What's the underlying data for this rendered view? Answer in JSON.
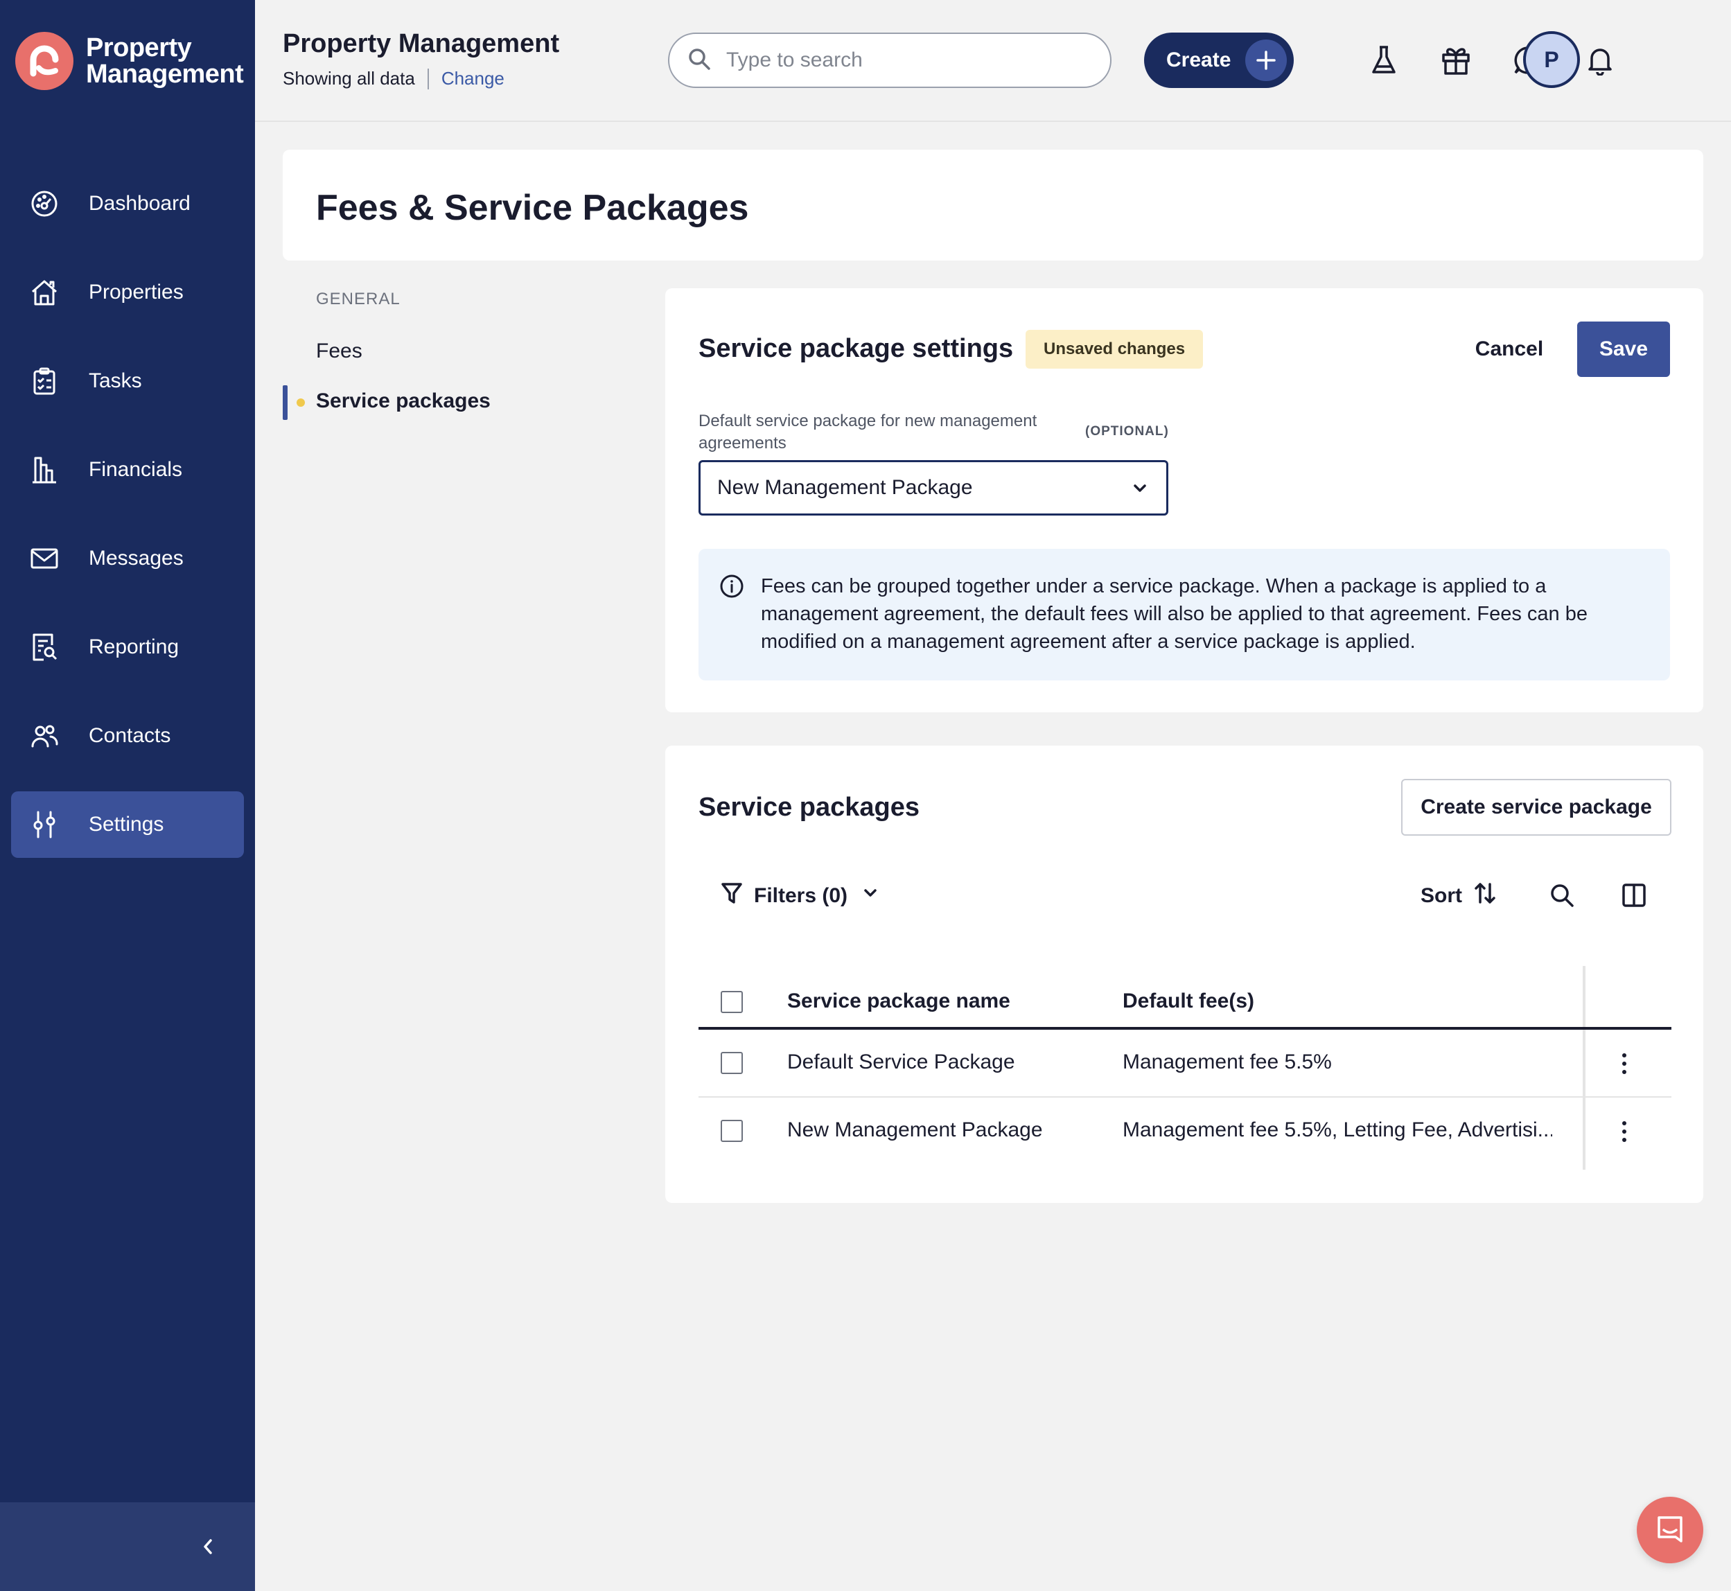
{
  "brand": {
    "name_line1": "Property",
    "name_line2": "Management",
    "color": "#e8706b"
  },
  "sidebar": {
    "items": [
      {
        "label": "Dashboard",
        "icon": "gauge-icon"
      },
      {
        "label": "Properties",
        "icon": "house-icon"
      },
      {
        "label": "Tasks",
        "icon": "clipboard-icon"
      },
      {
        "label": "Financials",
        "icon": "bank-icon"
      },
      {
        "label": "Messages",
        "icon": "envelope-icon"
      },
      {
        "label": "Reporting",
        "icon": "report-search-icon"
      },
      {
        "label": "Contacts",
        "icon": "people-icon"
      },
      {
        "label": "Settings",
        "icon": "sliders-icon",
        "active": true
      }
    ],
    "collapse_icon": "chevron-left-icon"
  },
  "header": {
    "title": "Property Management",
    "scope_text": "Showing all data",
    "change_link": "Change",
    "search_placeholder": "Type to search",
    "create_label": "Create",
    "icons": [
      "flask-icon",
      "gift-icon",
      "help-icon",
      "bell-icon"
    ],
    "avatar_initial": "P"
  },
  "page": {
    "title": "Fees & Service Packages"
  },
  "subnav": {
    "group": "GENERAL",
    "items": [
      {
        "label": "Fees"
      },
      {
        "label": "Service packages",
        "active": true
      }
    ]
  },
  "settings_card": {
    "title": "Service package settings",
    "badge": "Unsaved changes",
    "cancel_label": "Cancel",
    "save_label": "Save",
    "field_label": "Default service package for new management agreements",
    "field_optional": "(OPTIONAL)",
    "selected_value": "New Management Package",
    "info_text": "Fees can be grouped together under a service package. When a package is applied to a management agreement, the default fees will also be applied to that agreement. Fees can be modified on a management agreement after a service package is applied."
  },
  "packages_card": {
    "title": "Service packages",
    "create_label": "Create service package",
    "filters_label": "Filters (0)",
    "sort_label": "Sort",
    "columns": [
      "Service package name",
      "Default fee(s)"
    ],
    "rows": [
      {
        "name": "Default Service Package",
        "fees": "Management fee 5.5%"
      },
      {
        "name": "New Management Package",
        "fees": "Management fee 5.5%, Letting Fee, Advertisi..."
      }
    ]
  },
  "colors": {
    "sidebar": "#1a2b5e",
    "accent": "#3b5199",
    "badge": "#fcefc7",
    "info_bg": "#edf4fc"
  }
}
